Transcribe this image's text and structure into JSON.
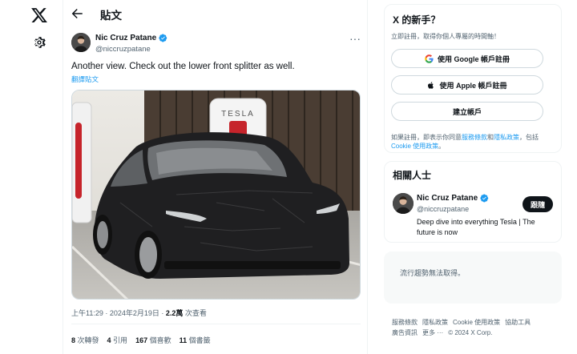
{
  "nav": {
    "logo_icon": "x-logo-icon",
    "settings_icon": "gear-icon"
  },
  "header": {
    "title": "貼文",
    "back_icon": "arrow-left-icon"
  },
  "tweet": {
    "author_name": "Nic Cruz Patane",
    "author_handle": "@niccruzpatane",
    "more_label": "···",
    "text": "Another view. Check out the lower front splitter as well.",
    "translate_label": "翻譯貼文",
    "image_alt": "Gray car under camouflage wrap at a charging station",
    "time": "上午11:29 · 2024年2月19日 · ",
    "views_count": "2.2萬",
    "views_label": " 次查看",
    "stats": {
      "reposts_count": "8",
      "reposts_label": " 次轉發",
      "quotes_count": "4",
      "quotes_label": " 引用",
      "likes_count": "167",
      "likes_label": " 個喜歡",
      "bookmarks_count": "11",
      "bookmarks_label": " 個書籤"
    }
  },
  "signup": {
    "title": "X 的新手？",
    "subtitle": "立即註冊，取得你個人專屬的時間軸！",
    "google_label": "使用 Google 帳戶註冊",
    "apple_label": "使用 Apple 帳戶註冊",
    "create_label": "建立帳戶",
    "terms_prefix": "如果註冊，即表示你同意",
    "terms_link": "服務條款",
    "terms_and": "和",
    "privacy_link": "隱私政策",
    "terms_include": "，包括 ",
    "cookie_link": "Cookie 使用政策",
    "terms_end": "。"
  },
  "related": {
    "title": "相關人士",
    "name": "Nic Cruz Patane",
    "handle": "@niccruzpatane",
    "follow_label": "跟隨",
    "bio": "Deep dive into everything Tesla | The future is now"
  },
  "trends": {
    "text": "流行趨勢無法取得。"
  },
  "footer": {
    "links": [
      "服務條款",
      "隱私政策",
      "Cookie 使用政策",
      "協助工具",
      "廣告資訊",
      "更多 ···"
    ],
    "copyright": "© 2024 X Corp."
  },
  "colors": {
    "accent": "#1d9bf0",
    "text": "#0f1419",
    "muted": "#536471",
    "border": "#eff3f4"
  }
}
